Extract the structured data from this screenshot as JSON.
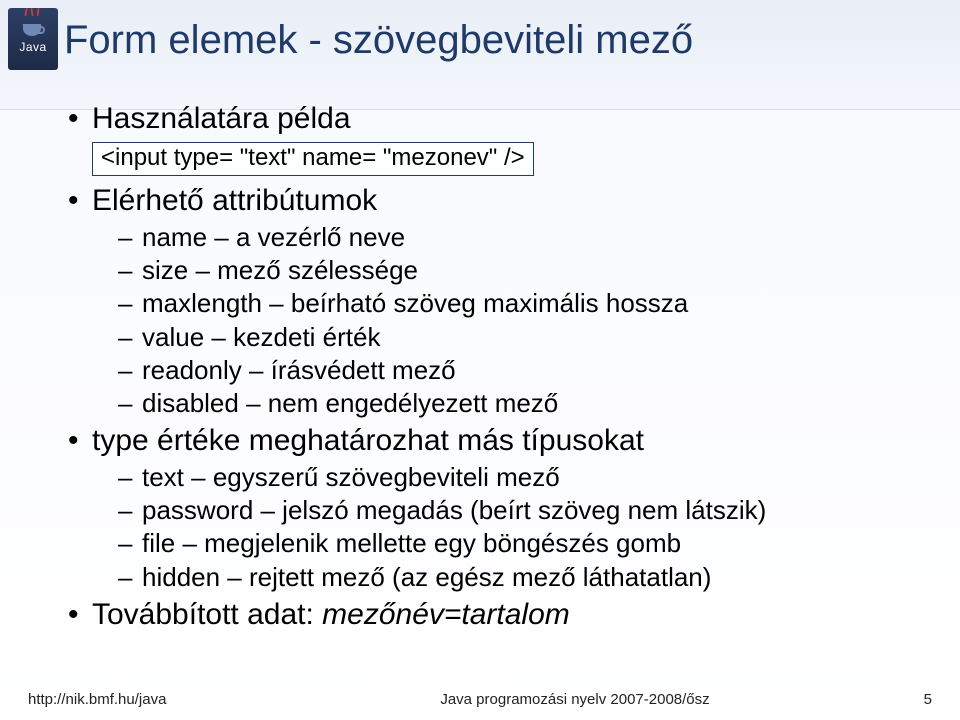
{
  "logo": {
    "text": "Java"
  },
  "title": "Form elemek - szövegbeviteli mező",
  "bullets": {
    "b1": "Használatára példa",
    "code": "<input type= \"text\" name= \"mezonev\" />",
    "b2": "Elérhető attribútumok",
    "b2items": {
      "i1": "name – a vezérlő neve",
      "i2": "size – mező szélessége",
      "i3": "maxlength – beírható szöveg maximális hossza",
      "i4": "value – kezdeti érték",
      "i5": "readonly – írásvédett mező",
      "i6": "disabled – nem engedélyezett mező"
    },
    "b3": "type értéke meghatározhat más típusokat",
    "b3items": {
      "i1": "text – egyszerű szövegbeviteli mező",
      "i2": "password – jelszó megadás (beírt szöveg nem látszik)",
      "i3": "file – megjelenik mellette egy böngészés gomb",
      "i4": "hidden – rejtett mező (az egész mező láthatatlan)"
    },
    "b4_prefix": "Továbbított adat: ",
    "b4_italic": "mezőnév=tartalom"
  },
  "footer": {
    "left": "http://nik.bmf.hu/java",
    "center": "Java programozási nyelv 2007-2008/ősz",
    "page": "5"
  }
}
